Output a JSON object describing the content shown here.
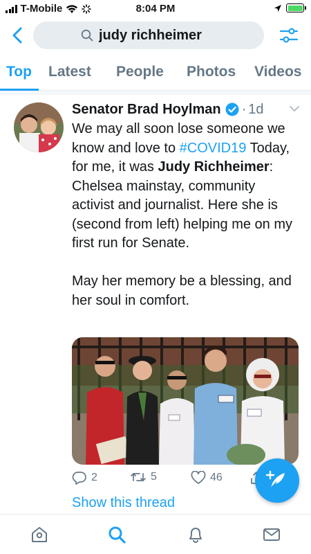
{
  "status_bar": {
    "carrier": "T-Mobile",
    "time": "8:04 PM"
  },
  "search": {
    "query": "judy richheimer",
    "icons": [
      "back-chevron-icon",
      "search-icon",
      "filter-sliders-icon"
    ]
  },
  "tabs": [
    {
      "label": "Top",
      "active": true
    },
    {
      "label": "Latest",
      "active": false
    },
    {
      "label": "People",
      "active": false
    },
    {
      "label": "Photos",
      "active": false
    },
    {
      "label": "Videos",
      "active": false
    }
  ],
  "tweet": {
    "author": "Senator Brad Hoylman",
    "verified": true,
    "separator": "·",
    "age": "1d",
    "text": {
      "p1_a": "We may all soon lose someone we know and love to ",
      "hashtag": "#COVID19",
      "p1_b": " Today, for me, it was ",
      "bold": "Judy Richheimer",
      "p1_c": ": Chelsea mainstay, community activist and journalist. Here she is (second from left) helping me on my first run for Senate.",
      "p2": "May her memory be a blessing, and her soul in comfort."
    },
    "actions": {
      "replies": "2",
      "retweets": "5",
      "likes": "46"
    },
    "show_thread": "Show this thread"
  },
  "bottom_nav": [
    "home-icon",
    "search-icon",
    "notifications-bell-icon",
    "messages-envelope-icon"
  ],
  "colors": {
    "accent": "#1da1f2",
    "muted": "#657786",
    "text": "#14171a",
    "divider": "#e6ecf0",
    "search_bg": "#e6ecf0"
  }
}
